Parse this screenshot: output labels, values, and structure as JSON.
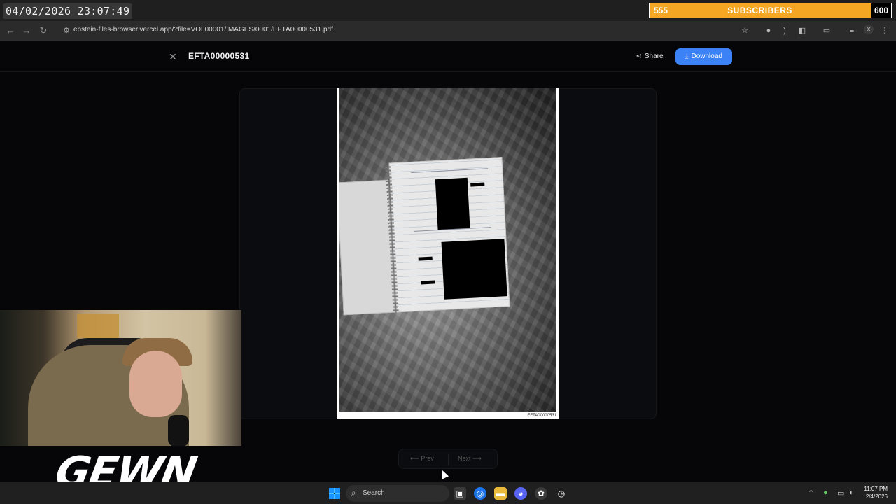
{
  "overlay": {
    "datetime": "04/02/2026 23:07:49",
    "subscribers_current": "555",
    "subscribers_label": "SUBSCRIBERS",
    "subscribers_goal": "600",
    "brand": "GEWN"
  },
  "browser": {
    "url": "epstein-files-browser.vercel.app/?file=VOL00001/IMAGES/0001/EFTA00000531.pdf",
    "profile_initial": "X"
  },
  "viewer": {
    "title": "EFTA00000531",
    "share_label": "Share",
    "download_label": "Download",
    "doc_stamp": "EFTA00000531",
    "prev_label": "Prev",
    "next_label": "Next"
  },
  "taskbar": {
    "search_placeholder": "Search",
    "time": "11:07 PM",
    "date": "2/4/2026"
  },
  "colors": {
    "accent": "#3b82f6",
    "subscriber_bar": "#f5a623",
    "page_background": "#060608"
  }
}
